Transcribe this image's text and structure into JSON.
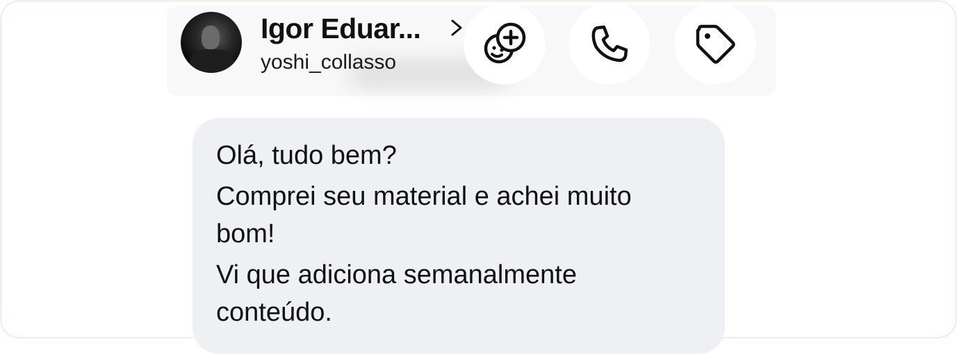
{
  "header": {
    "contact_name": "Igor Eduar...",
    "username": "yoshi_collasso",
    "chevron_icon": "chevron-right-icon",
    "buttons": [
      {
        "icon": "sticker-add-icon"
      },
      {
        "icon": "phone-icon"
      },
      {
        "icon": "tag-icon"
      }
    ]
  },
  "message": {
    "lines": [
      "Olá, tudo bem?",
      "Comprei seu material e achei muito",
      "bom!",
      "Vi que adiciona semanalmente",
      "conteúdo."
    ]
  },
  "colors": {
    "bubble_background": "#eef0f3",
    "frame_border": "#cfeec3",
    "text": "#111111"
  }
}
